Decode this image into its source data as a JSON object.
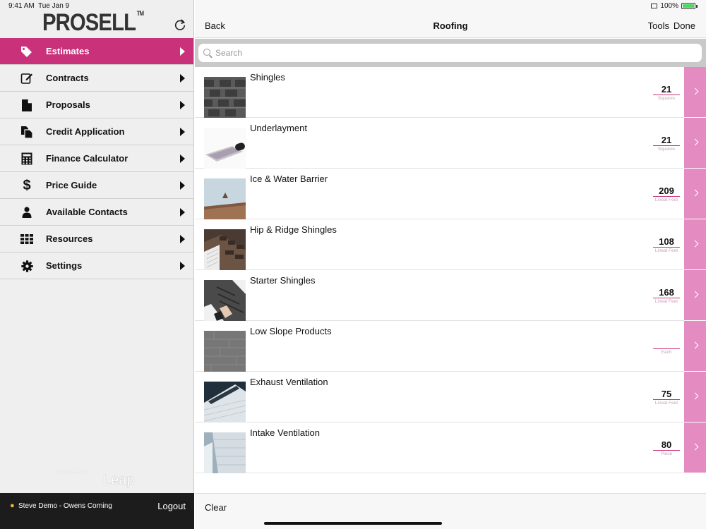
{
  "status": {
    "time": "9:41 AM",
    "date": "Tue Jan 9",
    "battery": "100%"
  },
  "brand": {
    "name": "PROSELL",
    "tm": "TM"
  },
  "sidebar": {
    "items": [
      {
        "label": "Estimates",
        "icon": "tag-icon",
        "active": true
      },
      {
        "label": "Contracts",
        "icon": "edit-icon",
        "active": false
      },
      {
        "label": "Proposals",
        "icon": "document-icon",
        "active": false
      },
      {
        "label": "Credit Application",
        "icon": "copy-icon",
        "active": false
      },
      {
        "label": "Finance Calculator",
        "icon": "calculator-icon",
        "active": false
      },
      {
        "label": "Price Guide",
        "icon": "dollar-icon",
        "active": false
      },
      {
        "label": "Available Contacts",
        "icon": "person-icon",
        "active": false
      },
      {
        "label": "Resources",
        "icon": "grid-icon",
        "active": false
      },
      {
        "label": "Settings",
        "icon": "gear-icon",
        "active": false
      }
    ],
    "powered_by": "powered by",
    "leap": "Leap",
    "user": "Steve Demo - Owens Corning",
    "logout": "Logout"
  },
  "navbar": {
    "back": "Back",
    "title": "Roofing",
    "tools": "Tools",
    "done": "Done"
  },
  "search": {
    "placeholder": "Search",
    "value": ""
  },
  "products": [
    {
      "name": "Shingles",
      "qty": "21",
      "unit": "Squares"
    },
    {
      "name": "Underlayment",
      "qty": "21",
      "unit": "Squares"
    },
    {
      "name": "Ice & Water Barrier",
      "qty": "209",
      "unit": "Lineal Feet"
    },
    {
      "name": "Hip & Ridge Shingles",
      "qty": "108",
      "unit": "Lineal Feet"
    },
    {
      "name": "Starter Shingles",
      "qty": "168",
      "unit": "Lineal Feet"
    },
    {
      "name": "Low Slope Products",
      "qty": "",
      "unit": "Each"
    },
    {
      "name": "Exhaust Ventilation",
      "qty": "75",
      "unit": "Lineal Feet"
    },
    {
      "name": "Intake Ventilation",
      "qty": "80",
      "unit": "Piece"
    }
  ],
  "footer": {
    "clear": "Clear"
  },
  "colors": {
    "accent": "#c9317a",
    "chevron_bg": "#e48cc1",
    "sidebar_bg": "#efefef",
    "footer_bg": "#1c1c1c"
  }
}
